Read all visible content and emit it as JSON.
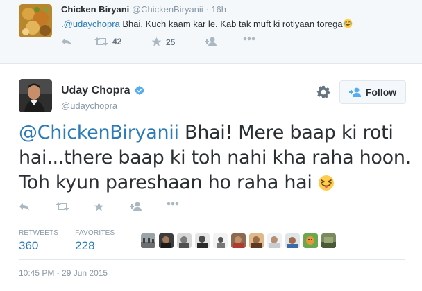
{
  "reply": {
    "name": "Chicken Biryani",
    "handle": "@ChickenBiryanii",
    "separator": "·",
    "time": "16h",
    "text_prefix": ".",
    "mention": "@udaychopra",
    "text_body": " Bhai, Kuch kaam kar le. Kab tak muft ki rotiyaan torega",
    "emoji": "face-with-tears-of-joy",
    "retweets": "42",
    "favorites": "25"
  },
  "tweet": {
    "name": "Uday Chopra",
    "handle": "@udaychopra",
    "follow_label": "Follow",
    "mention": "@ChickenBiryanii",
    "text_line1": " Bhai! Mere baap ki roti",
    "text_line2": "hai...there baap ki toh nahi kha raha hoon.",
    "text_line3": "Toh kyun pareshaan ho raha hai ",
    "emoji": "face-with-stuck-out-tongue-and-winking-eye"
  },
  "stats": {
    "retweets_label": "RETWEETS",
    "retweets_value": "360",
    "favorites_label": "FAVORITES",
    "favorites_value": "228"
  },
  "timestamp": "10:45 PM - 29 Jun 2015",
  "colors": {
    "link": "#2b7bb9",
    "muted": "#8899a6",
    "icon": "#aab8c2",
    "verified": "#55acee"
  },
  "icons": [
    "reply-icon",
    "retweet-icon",
    "favorite-icon",
    "follow-icon",
    "more-icon",
    "gear-icon",
    "verified-badge-icon"
  ]
}
